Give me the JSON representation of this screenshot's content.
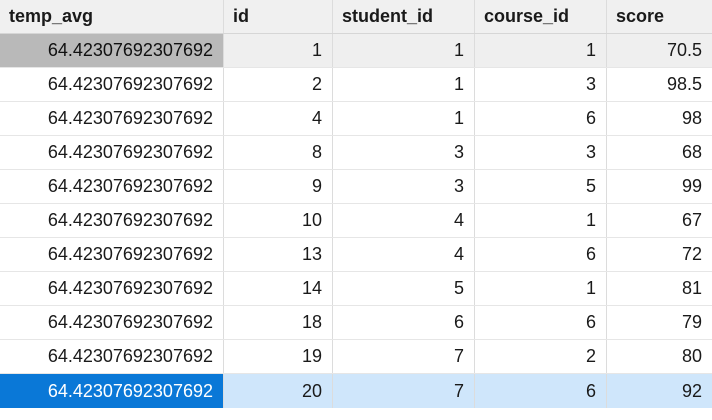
{
  "table": {
    "columns": [
      "temp_avg",
      "id",
      "student_id",
      "course_id",
      "score"
    ],
    "rows": [
      [
        "64.42307692307692",
        "1",
        "1",
        "1",
        "70.5"
      ],
      [
        "64.42307692307692",
        "2",
        "1",
        "3",
        "98.5"
      ],
      [
        "64.42307692307692",
        "4",
        "1",
        "6",
        "98"
      ],
      [
        "64.42307692307692",
        "8",
        "3",
        "3",
        "68"
      ],
      [
        "64.42307692307692",
        "9",
        "3",
        "5",
        "99"
      ],
      [
        "64.42307692307692",
        "10",
        "4",
        "1",
        "67"
      ],
      [
        "64.42307692307692",
        "13",
        "4",
        "6",
        "72"
      ],
      [
        "64.42307692307692",
        "14",
        "5",
        "1",
        "81"
      ],
      [
        "64.42307692307692",
        "18",
        "6",
        "6",
        "79"
      ],
      [
        "64.42307692307692",
        "19",
        "7",
        "2",
        "80"
      ],
      [
        "64.42307692307692",
        "20",
        "7",
        "6",
        "92"
      ]
    ],
    "focused_row_index": 0,
    "selected_row_index": 10
  },
  "colors": {
    "header_bg": "#f0f0f0",
    "focused_cell": "#b9b9b9",
    "selected_cell": "#0a78d7",
    "selected_row": "#cfe6fb"
  }
}
